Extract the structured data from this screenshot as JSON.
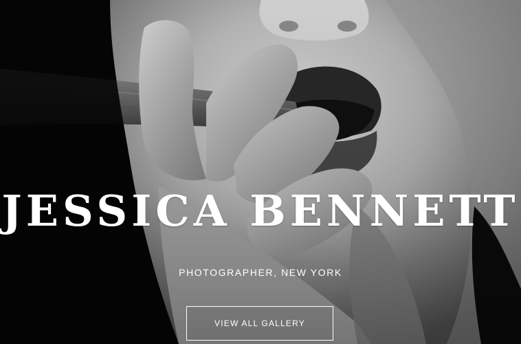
{
  "hero": {
    "title": "JESSICA BENNETT",
    "subtitle": "PHOTOGRAPHER, NEW YORK",
    "cta_label": "VIEW ALL GALLERY"
  },
  "colors": {
    "text": "#ffffff",
    "background": "#0b0b0b"
  }
}
